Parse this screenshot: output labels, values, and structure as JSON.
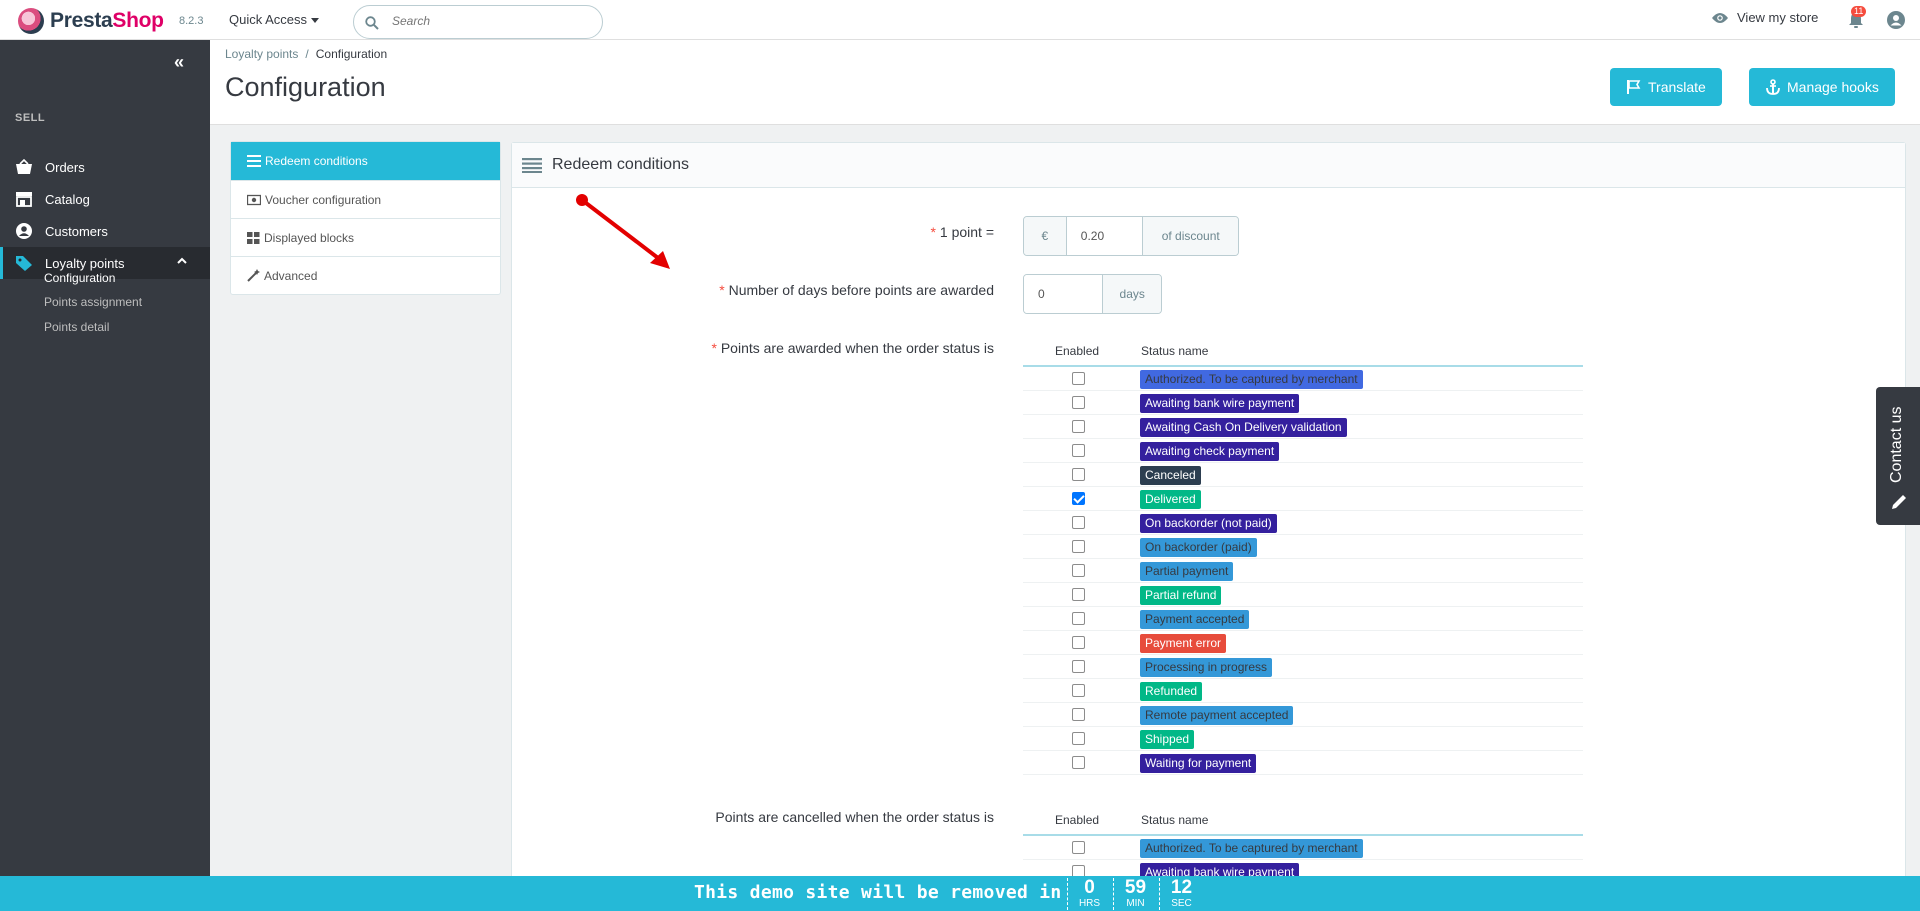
{
  "header": {
    "brand_prefix": "Presta",
    "brand_suffix": "Shop",
    "version": "8.2.3",
    "quick_access": "Quick Access",
    "search_placeholder": "Search",
    "view_store": "View my store",
    "notifications_count": "11"
  },
  "sidebar": {
    "section": "SELL",
    "items": [
      {
        "label": "Orders",
        "icon": "basket-icon"
      },
      {
        "label": "Catalog",
        "icon": "store-icon"
      },
      {
        "label": "Customers",
        "icon": "account-circle-icon"
      },
      {
        "label": "Loyalty points",
        "icon": "tag-icon"
      }
    ],
    "subitems": [
      "Configuration",
      "Points assignment",
      "Points detail"
    ]
  },
  "breadcrumb": {
    "parent": "Loyalty points",
    "current": "Configuration"
  },
  "page_title": "Configuration",
  "toolbar": {
    "translate": "Translate",
    "manage_hooks": "Manage hooks"
  },
  "tabs": [
    "Redeem conditions",
    "Voucher configuration",
    "Displayed blocks",
    "Advanced"
  ],
  "panel": {
    "title": "Redeem conditions",
    "point_label": "1 point =",
    "currency": "€",
    "point_value": "0.20",
    "point_suffix": "of discount",
    "days_label": "Number of days before points are awarded",
    "days_value": "0",
    "days_suffix": "days",
    "awarded_label": "Points are awarded when the order status is",
    "cancelled_label": "Points are cancelled when the order status is",
    "col_enabled": "Enabled",
    "col_status": "Status name"
  },
  "statuses": [
    {
      "name": "Authorized. To be captured by merchant",
      "bg": "#4169e1",
      "fg": "#363a41",
      "checked": false
    },
    {
      "name": "Awaiting bank wire payment",
      "bg": "#34209e",
      "fg": "#ffffff",
      "checked": false
    },
    {
      "name": "Awaiting Cash On Delivery validation",
      "bg": "#34209e",
      "fg": "#ffffff",
      "checked": false
    },
    {
      "name": "Awaiting check payment",
      "bg": "#34209e",
      "fg": "#ffffff",
      "checked": false
    },
    {
      "name": "Canceled",
      "bg": "#2c3e50",
      "fg": "#ffffff",
      "checked": false
    },
    {
      "name": "Delivered",
      "bg": "#01b887",
      "fg": "#ffffff",
      "checked": true
    },
    {
      "name": "On backorder (not paid)",
      "bg": "#34209e",
      "fg": "#ffffff",
      "checked": false
    },
    {
      "name": "On backorder (paid)",
      "bg": "#3498d8",
      "fg": "#363a41",
      "checked": false
    },
    {
      "name": "Partial payment",
      "bg": "#3498d8",
      "fg": "#363a41",
      "checked": false
    },
    {
      "name": "Partial refund",
      "bg": "#01b887",
      "fg": "#ffffff",
      "checked": false
    },
    {
      "name": "Payment accepted",
      "bg": "#3498d8",
      "fg": "#363a41",
      "checked": false
    },
    {
      "name": "Payment error",
      "bg": "#e74c3c",
      "fg": "#ffffff",
      "checked": false
    },
    {
      "name": "Processing in progress",
      "bg": "#3498d8",
      "fg": "#363a41",
      "checked": false
    },
    {
      "name": "Refunded",
      "bg": "#01b887",
      "fg": "#ffffff",
      "checked": false
    },
    {
      "name": "Remote payment accepted",
      "bg": "#3498d8",
      "fg": "#363a41",
      "checked": false
    },
    {
      "name": "Shipped",
      "bg": "#01b887",
      "fg": "#ffffff",
      "checked": false
    },
    {
      "name": "Waiting for payment",
      "bg": "#34209e",
      "fg": "#ffffff",
      "checked": false
    }
  ],
  "cancelled_statuses": [
    {
      "name": "Authorized. To be captured by merchant",
      "bg": "#3498d8",
      "fg": "#363a41",
      "checked": false
    },
    {
      "name": "Awaiting bank wire payment",
      "bg": "#34209e",
      "fg": "#ffffff",
      "checked": false
    }
  ],
  "contact": "Contact us",
  "demo": {
    "message": "This demo site will be removed in",
    "hours": "0",
    "hours_label": "HRS",
    "minutes": "59",
    "minutes_label": "MIN",
    "seconds": "12",
    "seconds_label": "SEC"
  }
}
